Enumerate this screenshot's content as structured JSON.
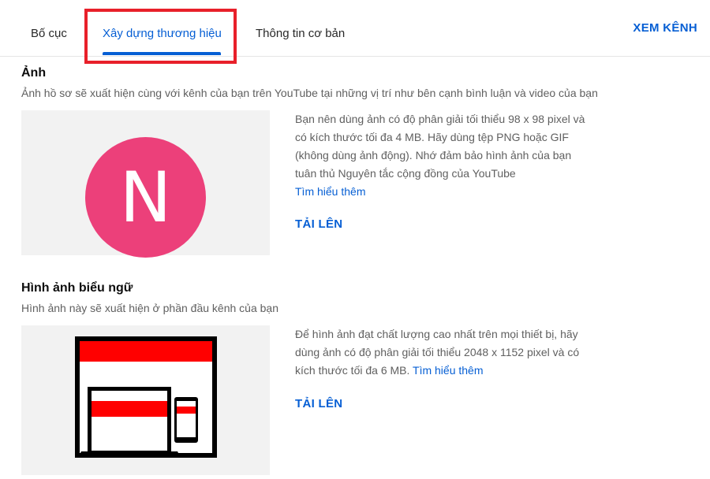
{
  "tabs": [
    {
      "label": "Bố cục"
    },
    {
      "label": "Xây dựng thương hiệu"
    },
    {
      "label": "Thông tin cơ bản"
    }
  ],
  "header": {
    "view_channel": "XEM KÊNH"
  },
  "photo": {
    "title": "Ảnh",
    "subtitle": "Ảnh hồ sơ sẽ xuất hiện cùng với kênh của bạn trên YouTube tại những vị trí như bên cạnh bình luận và video của bạn",
    "avatar_letter": "N",
    "avatar_color": "#ec407a",
    "description": "Bạn nên dùng ảnh có độ phân giải tối thiểu 98 x 98 pixel và có kích thước tối đa 4 MB. Hãy dùng tệp PNG hoặc GIF (không dùng ảnh động). Nhớ đảm bảo hình ảnh của bạn tuân thủ Nguyên tắc cộng đồng của YouTube",
    "learn_more": "Tìm hiểu thêm",
    "upload": "TẢI LÊN"
  },
  "banner": {
    "title": "Hình ảnh biểu ngữ",
    "subtitle": "Hình ảnh này sẽ xuất hiện ở phần đầu kênh của bạn",
    "description": "Để hình ảnh đạt chất lượng cao nhất trên mọi thiết bị, hãy dùng ảnh có độ phân giải tối thiểu 2048 x 1152 pixel và có kích thước tối đa 6 MB.",
    "learn_more": "Tìm hiểu thêm",
    "upload": "TẢI LÊN"
  },
  "colors": {
    "accent": "#065fd4",
    "highlight": "#e8202a",
    "banner_red": "#ff0000"
  }
}
